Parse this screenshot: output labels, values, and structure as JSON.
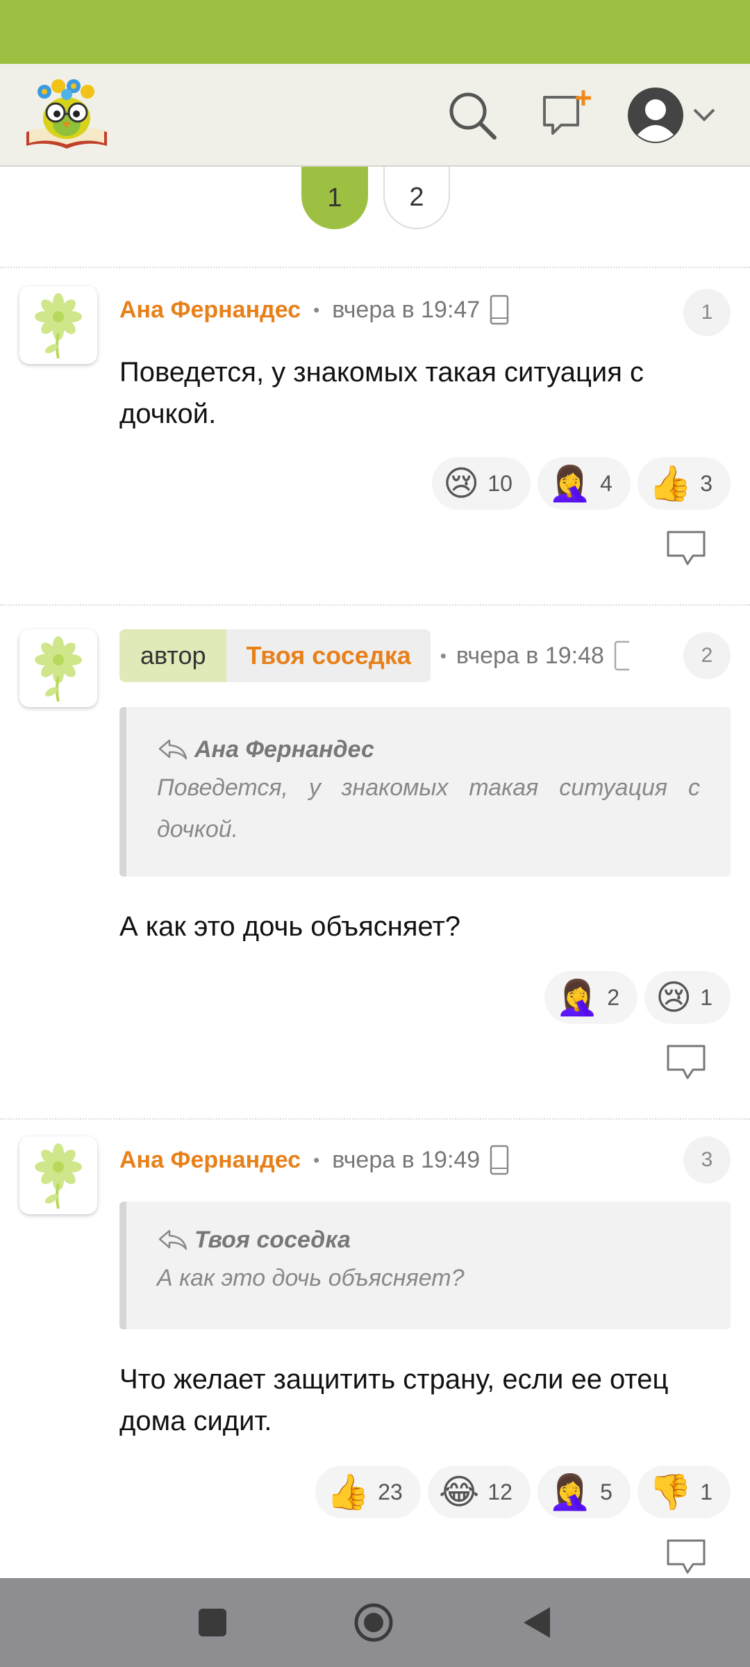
{
  "header": {
    "logo": "owl-book-logo",
    "search_icon": "search-icon",
    "new_topic_icon": "new-topic-icon",
    "avatar_icon": "user-avatar-icon",
    "menu_icon": "chevron-down-icon"
  },
  "pagination": {
    "pages": [
      "1",
      "2"
    ],
    "active": "1"
  },
  "comments": [
    {
      "author": "Ана Фернандес",
      "time": "вчера в 19:47",
      "number": "1",
      "text": "Поведется, у знакомых такая ситуация с дочкой.",
      "reactions": [
        {
          "emoji": "😢",
          "count": "10"
        },
        {
          "emoji": "🤦‍♀️",
          "count": "4"
        },
        {
          "emoji": "👍",
          "count": "3"
        }
      ]
    },
    {
      "author_tag": "автор",
      "author": "Твоя соседка",
      "time": "вчера в 19:48",
      "number": "2",
      "quote_author": "Ана Фернандес",
      "quote_text": "Поведется, у знакомых такая ситуация с дочкой.",
      "text": "А как это дочь объясняет?",
      "reactions": [
        {
          "emoji": "🤦‍♀️",
          "count": "2"
        },
        {
          "emoji": "😢",
          "count": "1"
        }
      ]
    },
    {
      "author": "Ана Фернандес",
      "time": "вчера в 19:49",
      "number": "3",
      "quote_author": "Твоя соседка",
      "quote_text": "А как это дочь объясняет?",
      "text": "Что желает защитить страну, если ее отец дома сидит.",
      "reactions": [
        {
          "emoji": "👍",
          "count": "23"
        },
        {
          "emoji": "😂",
          "count": "12"
        },
        {
          "emoji": "🤦‍♀️",
          "count": "5"
        },
        {
          "emoji": "👎",
          "count": "1"
        }
      ]
    }
  ],
  "colors": {
    "status_bar": "#9dc043",
    "accent_orange": "#e8801a",
    "author_tag_bg": "#dfeab8"
  }
}
